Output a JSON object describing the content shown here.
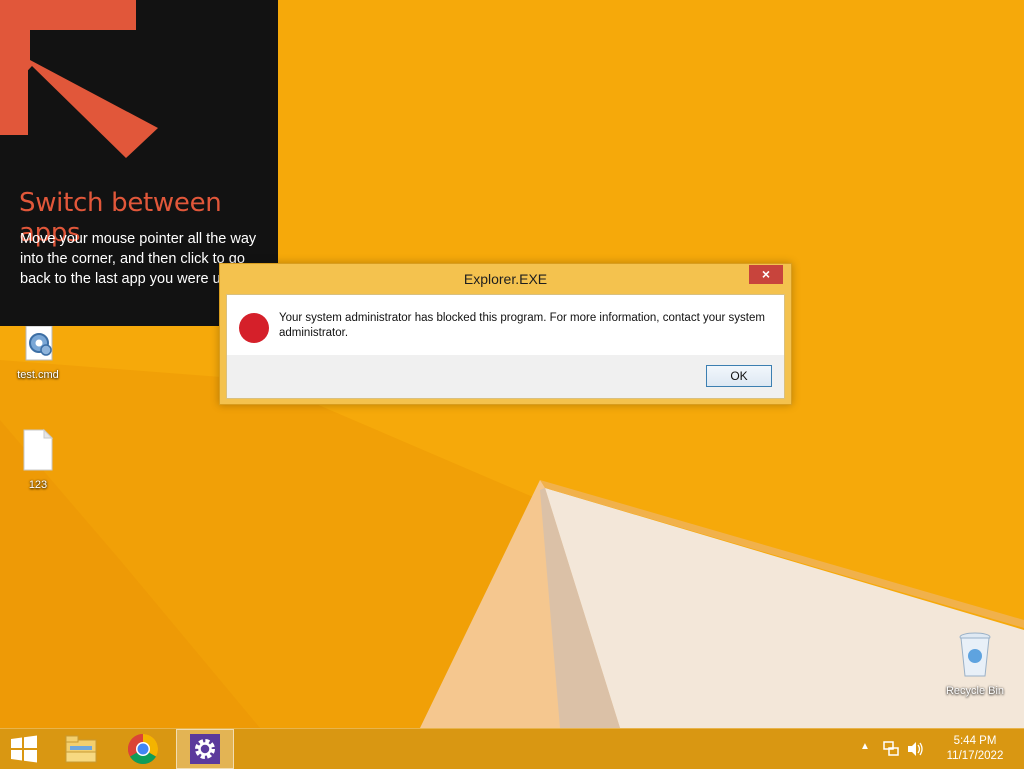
{
  "tip": {
    "title": "Switch between apps",
    "text": "Move your mouse pointer all the way into the corner, and then click to go back to the last app you were using."
  },
  "dialog": {
    "title": "Explorer.EXE",
    "close_label": "×",
    "message": "Your system administrator has blocked this program. For more information, contact your system administrator.",
    "ok_label": "OK"
  },
  "desktop": {
    "icons": [
      {
        "label": "test.cmd",
        "icon": "gear-script-icon"
      },
      {
        "label": "123",
        "icon": "blank-file-icon"
      },
      {
        "label": "Recycle Bin",
        "icon": "recycle-bin-icon"
      }
    ]
  },
  "taskbar": {
    "items": [
      {
        "name": "start",
        "icon": "windows-logo-icon"
      },
      {
        "name": "file-explorer",
        "icon": "folder-icon"
      },
      {
        "name": "chrome",
        "icon": "chrome-icon"
      },
      {
        "name": "settings",
        "icon": "gear-icon",
        "active": true
      }
    ],
    "clock": {
      "time": "5:44 PM",
      "date": "11/17/2022"
    }
  },
  "colors": {
    "wallpaper": "#f6a90a",
    "tip_background": "#121212",
    "tip_accent": "#e1573a",
    "taskbar": "#d69614",
    "close_button": "#c8443c"
  }
}
